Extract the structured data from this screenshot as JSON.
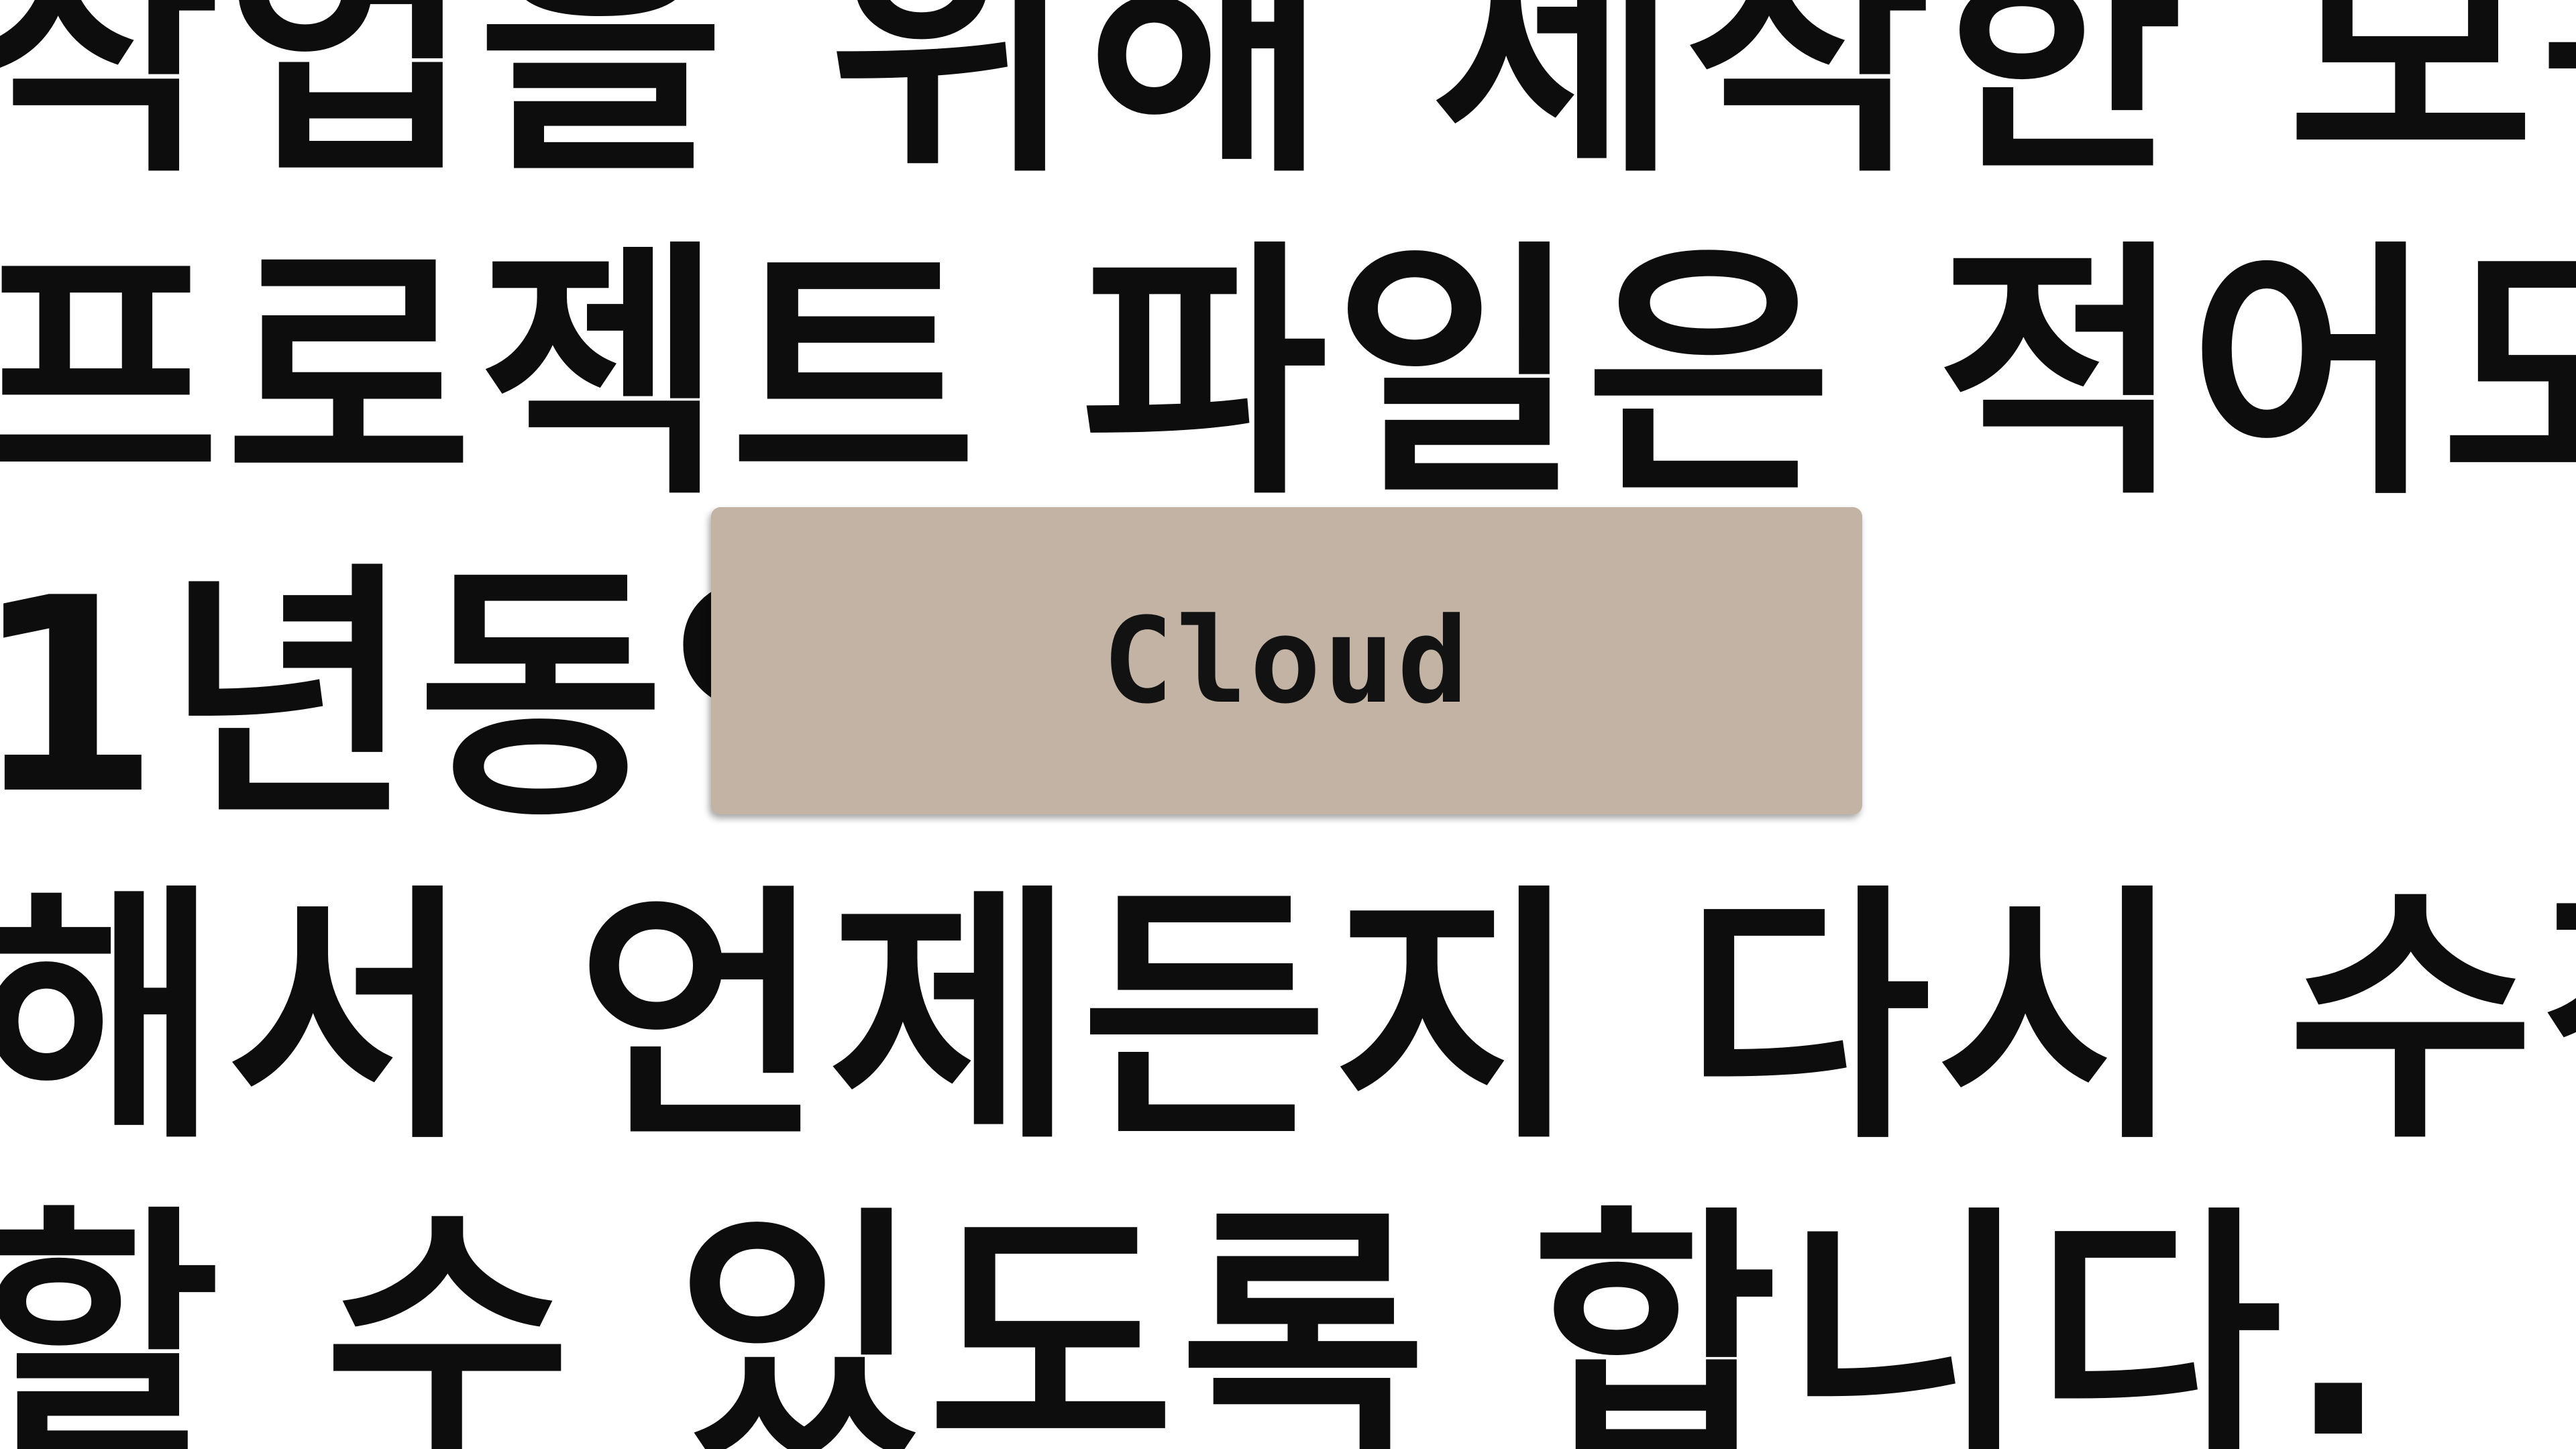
{
  "body_text": {
    "lines": [
      "작업을 위해 제작한 모든",
      "프로젝트 파일은 적어도",
      "1년동안 보관을",
      "해서 언제든지 다시 수정",
      "할 수 있도록 합니다."
    ]
  },
  "overlay": {
    "label": "Cloud",
    "color": "#c2b3a4"
  }
}
